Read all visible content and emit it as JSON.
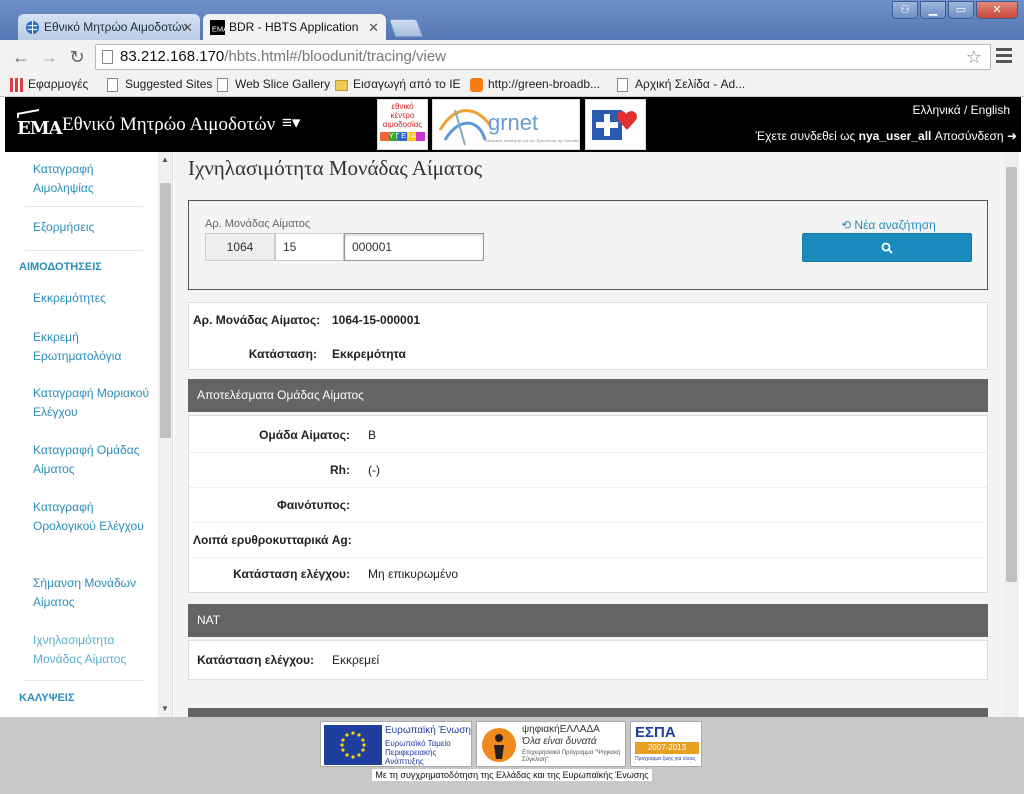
{
  "browser": {
    "tabs": [
      {
        "title": "Εθνικό Μητρώο Αιμοδοτών",
        "active": false
      },
      {
        "title": "BDR - HBTS Application",
        "active": true
      }
    ],
    "url_host": "83.212.168.170",
    "url_path": "/hbts.html#/bloodunit/tracing/view",
    "bookmarks": [
      {
        "label": "Εφαρμογές",
        "icon": "apps-icon"
      },
      {
        "label": "Suggested Sites",
        "icon": "page-icon"
      },
      {
        "label": "Web Slice Gallery",
        "icon": "page-icon"
      },
      {
        "label": "Εισαγωγή από το IE",
        "icon": "folder-icon"
      },
      {
        "label": "http://green-broadb...",
        "icon": "blogger-icon"
      },
      {
        "label": "Αρχική Σελίδα - Ad...",
        "icon": "page-icon"
      }
    ]
  },
  "header": {
    "logo_text": "ΕΜΑ",
    "title": "Εθνικό Μητρώο Αιμοδοτών",
    "menu_icon": "≡▾",
    "lang": "Ελληνικά / English",
    "user_prefix": "Έχετε συνδεθεί ως",
    "username": "nya_user_all",
    "logout": "Αποσύνδεση",
    "partner_logo1_lines": [
      "εθνικό",
      "κέντρο",
      "αιμοδοσίας"
    ],
    "partner_logo1_bar": "Υ Γ Ε Ι Α",
    "partner_logo2_name": "grnet",
    "partner_logo2_tagline": "Δικτυακός υποδομής για την Έρευνα και την Εκπαίδευση"
  },
  "sidebar": {
    "items": [
      {
        "label": "Καταγραφή Αιμοληψίας"
      },
      {
        "label": "Εξορμήσεις"
      },
      {
        "label": "ΑΙΜΟΔΟΤΗΣΕΙΣ"
      },
      {
        "label": "Εκκρεμότητες"
      },
      {
        "label": "Εκκρεμή Ερωτηματολόγια"
      },
      {
        "label": "Καταγραφή Μοριακού Ελέγχου"
      },
      {
        "label": "Καταγραφή Ομάδας Αίματος"
      },
      {
        "label": "Καταγραφή Ορολογικού Ελέγχου"
      },
      {
        "label": "Σήμανση Μονάδων Αίματος"
      },
      {
        "label": "Ιχνηλασιμότητα Μονάδας Αίματος"
      },
      {
        "label": "ΚΑΛΥΨΕΙΣ"
      }
    ]
  },
  "main": {
    "title": "Ιχνηλασιμότητα Μονάδας Αίματος",
    "search": {
      "label": "Αρ. Μονάδας Αίματος",
      "part1": "1064",
      "part2": "15",
      "part3": "000001",
      "new_search": "Νέα αναζήτηση"
    },
    "summary": {
      "unit_label": "Αρ. Μονάδας Αίματος:",
      "unit_value": "1064-15-000001",
      "status_label": "Κατάσταση:",
      "status_value": "Εκκρεμότητα"
    },
    "blood_group_section": {
      "title": "Αποτελέσματα Ομάδας Αίματος",
      "rows": [
        {
          "label": "Ομάδα Αίματος:",
          "value": "B"
        },
        {
          "label": "Rh:",
          "value": "(-)"
        },
        {
          "label": "Φαινότυπος:",
          "value": ""
        },
        {
          "label": "Λοιπά ερυθροκυτταρικά Ag:",
          "value": ""
        },
        {
          "label": "Κατάσταση ελέγχου:",
          "value": "Μη επικυρωμένο"
        }
      ]
    },
    "nat_section": {
      "title": "NAT",
      "rows": [
        {
          "label": "Κατάσταση ελέγχου:",
          "value": "Εκκρεμεί"
        }
      ]
    }
  },
  "footer": {
    "eu_title": "Ευρωπαϊκή Ένωση",
    "eu_fund": "Ευρωπαϊκό Ταμείο Περιφερειακής Ανάπτυξης",
    "digital_title": "ψηφιακήΕΛΛΑΔΑ",
    "digital_slogan": "Όλα είναι δυνατά",
    "digital_program": "Επιχειρησιακό Πρόγραμμα \"Ψηφιακή Σύγκλιση\"",
    "espa_title": "ΕΣΠΑ",
    "espa_years": "2007-2013",
    "espa_tagline": "Πρόγραμμα ζωής για όλους",
    "caption": "Με τη συγχρηματοδότηση της Ελλάδας και της Ευρωπαϊκής Ένωσης"
  },
  "colors": {
    "accent": "#1b8bbd",
    "header_bg": "#000000",
    "section_head": "#646464"
  }
}
